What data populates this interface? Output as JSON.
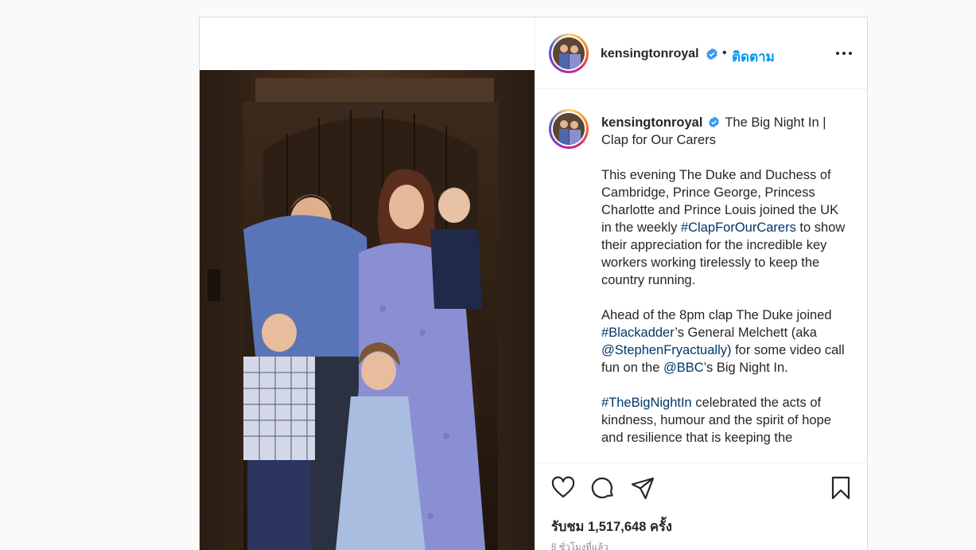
{
  "post": {
    "username": "kensingtonroyal",
    "follow_label": "ติดตาม",
    "dot": "•",
    "caption": {
      "title": "The Big Night In | Clap for Our Carers",
      "p1_a": "This evening The Duke and Duchess of Cambridge, Prince George, Princess Charlotte and Prince Louis joined the UK in the weekly ",
      "p1_tag": "#ClapForOurCarers",
      "p1_b": " to show their appreciation for the incredible key workers working tirelessly to keep the country running.",
      "p2_a": "Ahead of the 8pm clap The Duke joined ",
      "p2_tag1": "#Blackadder",
      "p2_b": "’s General Melchett (aka ",
      "p2_tag2": "@StephenFryactually",
      "p2_c": ") for some video call fun on the ",
      "p2_tag3": "@BBC",
      "p2_d": "’s Big Night In.",
      "p3_tag": "#TheBigNightIn",
      "p3_a": " celebrated the acts of kindness, humour and the spirit of hope and resilience that is keeping the"
    },
    "views": "รับชม 1,517,648 ครั้ง",
    "time": "8 ชั่วโมงที่แล้ว",
    "icons": {
      "verified": "verified-badge-icon",
      "more": "more-options-icon",
      "like": "heart-icon",
      "comment": "comment-icon",
      "share": "paper-plane-icon",
      "save": "bookmark-icon"
    },
    "colors": {
      "link": "#0095f6",
      "hashtag": "#00376b",
      "verified": "#3897f0"
    }
  }
}
